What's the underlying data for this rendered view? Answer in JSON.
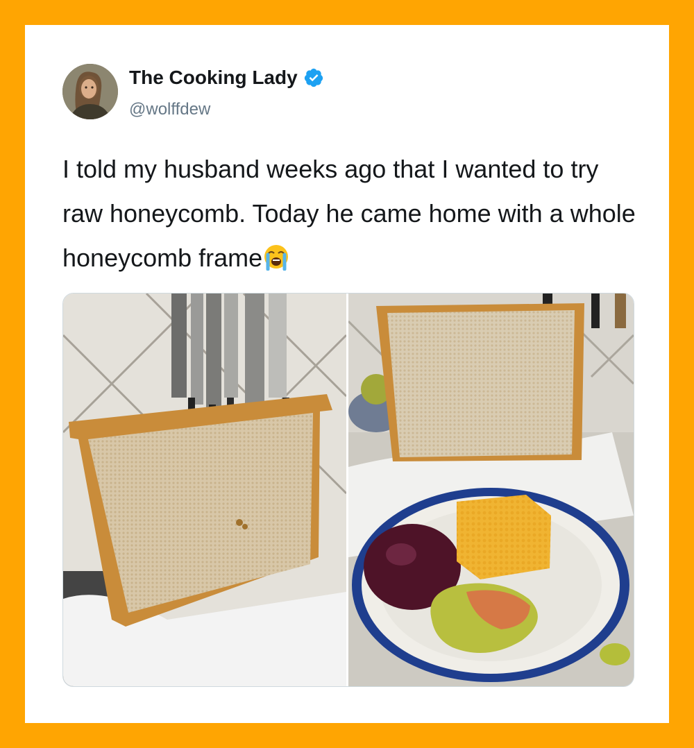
{
  "tweet": {
    "display_name": "The Cooking Lady",
    "handle": "@wolffdew",
    "text": "I told my husband weeks ago that I wanted to try raw honeycomb. Today he came home with a whole honeycomb frame",
    "emoji": "loudly-crying-face-icon"
  },
  "icons": {
    "verified": "verified-badge-icon"
  },
  "colors": {
    "frame_border": "#ffa502",
    "card_background": "#ffffff",
    "verified_blue": "#1da1f2",
    "handle_gray": "#657786",
    "text_dark": "#14171a"
  },
  "media": {
    "photos": [
      "honeycomb-frame-with-knives-photo",
      "plate-with-plum-honeycomb-pear-photo"
    ]
  }
}
